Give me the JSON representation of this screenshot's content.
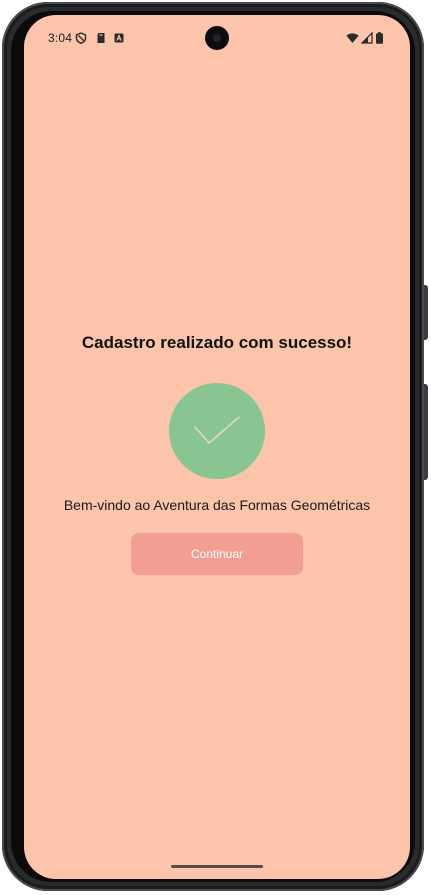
{
  "status_bar": {
    "time": "3:04",
    "left_icons": [
      "shield-icon",
      "sd-card-icon",
      "android-app-icon"
    ],
    "right_icons": [
      "wifi-icon",
      "cell-signal-icon",
      "battery-icon"
    ]
  },
  "screen": {
    "background_color": "#fcc4ab",
    "title": "Cadastro realizado com sucesso!",
    "badge": {
      "icon": "checkmark-icon",
      "color": "#88c593"
    },
    "message": "Bem-vindo ao Aventura das Formas Geométricas",
    "continue_button": {
      "label": "Continuar",
      "color": "#f29e94"
    }
  }
}
